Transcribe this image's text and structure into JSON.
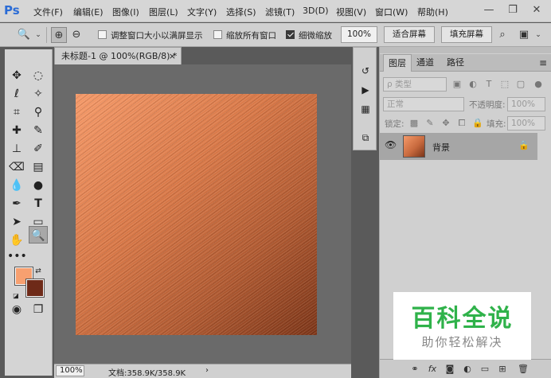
{
  "app": {
    "logo": "Ps"
  },
  "menu": [
    "文件(F)",
    "编辑(E)",
    "图像(I)",
    "图层(L)",
    "文字(Y)",
    "选择(S)",
    "滤镜(T)",
    "3D(D)",
    "视图(V)",
    "窗口(W)",
    "帮助(H)"
  ],
  "window_controls": {
    "minimize": "—",
    "restore": "❐",
    "close": "✕"
  },
  "options": {
    "resize_windows_label": "调整窗口大小以满屏显示",
    "resize_windows_checked": false,
    "zoom_all_label": "缩放所有窗口",
    "zoom_all_checked": false,
    "scrubby_zoom_label": "细微缩放",
    "scrubby_zoom_checked": true,
    "zoom_value": "100%",
    "fit_screen": "适合屏幕",
    "fill_screen": "填充屏幕"
  },
  "document": {
    "tab_title": "未标题-1 @ 100%(RGB/8) *",
    "close": "×",
    "status_zoom": "100%",
    "status_info": "文档:358.9K/358.9K",
    "status_arrow": "›"
  },
  "layers_panel": {
    "tabs": [
      "图层",
      "通道",
      "路径"
    ],
    "active_tab": 0,
    "menu": "≡",
    "filter_kind": "ρ 类型",
    "blend_mode": "正常",
    "opacity_label": "不透明度:",
    "opacity_value": "100%",
    "lock_label": "锁定:",
    "fill_label": "填充:",
    "fill_value": "100%",
    "layers": [
      {
        "name": "背景",
        "visible": true,
        "locked": true
      }
    ]
  },
  "colors": {
    "foreground": "#f7a070",
    "background": "#6e2a18",
    "accent": "#2b6cd6"
  },
  "watermark": {
    "title": "百科全说",
    "subtitle": "助你轻松解决"
  }
}
